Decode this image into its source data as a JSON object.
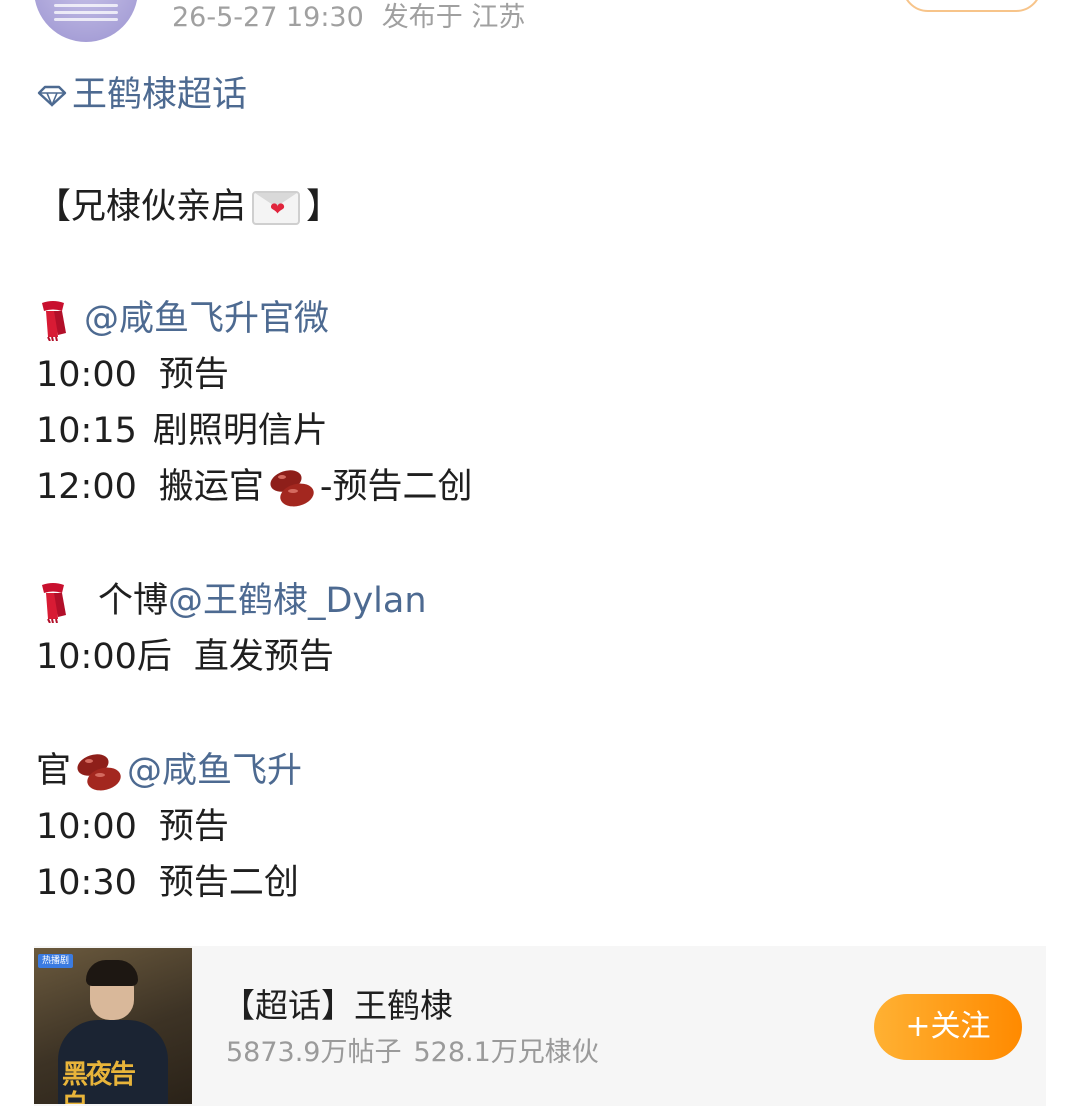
{
  "post": {
    "timestamp": "26-5-27 19:30",
    "location": "发布于 江苏"
  },
  "content": {
    "topic_link": "王鹤棣超话",
    "title_open": "【兄棣伙亲启",
    "title_close": "】",
    "section1": {
      "mention": "@咸鱼飞升官微",
      "rows": [
        {
          "time": "10:00",
          "text": "预告"
        },
        {
          "time": "10:15",
          "text": "剧照明信片"
        },
        {
          "time": "12:00",
          "text": "搬运官",
          "suffix": "-预告二创"
        }
      ]
    },
    "section2": {
      "label": "个博",
      "mention": "@王鹤棣_Dylan",
      "rows": [
        {
          "time": "10:00后",
          "text": "直发预告"
        }
      ]
    },
    "section3": {
      "label": "官",
      "mention": "@咸鱼飞升",
      "rows": [
        {
          "time": "10:00",
          "text": "预告"
        },
        {
          "time": "10:30",
          "text": "预告二创"
        }
      ]
    }
  },
  "topic_card": {
    "title": "【超话】王鹤棣",
    "stats_posts": "5873.9万帖子",
    "stats_members": "528.1万兄棣伙",
    "follow_label": "+关注",
    "cover_tag": "热播剧",
    "cover_title": "黑夜告白"
  },
  "colors": {
    "link": "#4d6a91",
    "follow_orange": "#ff8a00",
    "meta_gray": "#a0a0a0"
  },
  "icons": {
    "topic": "diamond-icon",
    "scarf": "red-scarf-emoji",
    "bean": "red-bean-emoji",
    "envelope": "love-letter-emoji"
  }
}
